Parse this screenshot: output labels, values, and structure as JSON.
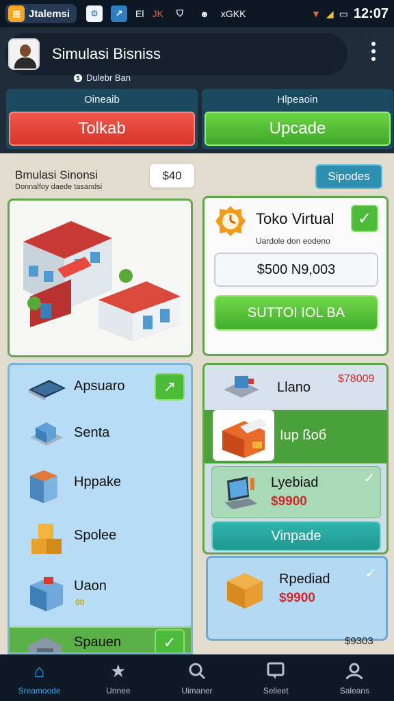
{
  "status_bar": {
    "app_name": "Jtalemsi",
    "icon_texts": [
      "El",
      "JK"
    ],
    "carrier": "xGKK",
    "time": "12:07"
  },
  "header": {
    "title": "Simulasi Bisniss",
    "subtitle": "Dulebr Ban"
  },
  "actions": {
    "left": {
      "caption": "Oineaib",
      "button": "Tolkab"
    },
    "right": {
      "caption": "Hlpeaoin",
      "button": "Upcade"
    }
  },
  "panel": {
    "title": "Bmulasi Sinonsi",
    "subtitle": "Donnalfoy daede tasandsi",
    "money": "$40",
    "speed_button": "Sipodes"
  },
  "toko": {
    "title": "Toko Virtual",
    "subtitle": "Uardole don eodeno",
    "price": "$500 N9,003",
    "button": "SUTTOI IOL BA"
  },
  "left_list": [
    {
      "label": "Apsuaro",
      "icon": "solar-panel-icon"
    },
    {
      "label": "Senta",
      "icon": "office-icon"
    },
    {
      "label": "Hppake",
      "icon": "building-icon"
    },
    {
      "label": "Spolee",
      "icon": "crates-icon"
    },
    {
      "label": "Uaon",
      "icon": "shop-icon",
      "badge": "00"
    },
    {
      "label": "Spauen",
      "icon": "warehouse-icon"
    }
  ],
  "right_list": {
    "row1": {
      "label": "Llano",
      "price": "$78009"
    },
    "row2": {
      "label": "Iup ßoб"
    },
    "row3": {
      "label": "Lyebiad",
      "price": "$9900"
    },
    "button": "Vinpade"
  },
  "rpedial": {
    "label": "Rpediad",
    "price": "$9900"
  },
  "corner_value": "$9303",
  "bottom_nav": [
    {
      "label": "Sreamoode",
      "icon": "home-icon"
    },
    {
      "label": "Unnee",
      "icon": "star-icon"
    },
    {
      "label": "Uimaner",
      "icon": "search-icon"
    },
    {
      "label": "Selieet",
      "icon": "message-icon"
    },
    {
      "label": "Saleans",
      "icon": "profile-icon"
    }
  ],
  "colors": {
    "red_button": "#e0453a",
    "green_button": "#55c037",
    "accent_blue": "#35a7f0",
    "dark_bg": "#1d2a38"
  }
}
